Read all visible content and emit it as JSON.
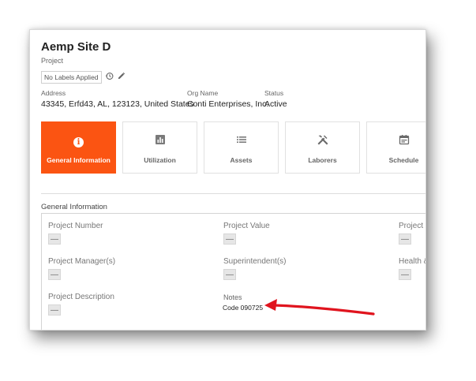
{
  "header": {
    "title": "Aemp Site D",
    "subtitle": "Project",
    "labels_chip": "No Labels Applied"
  },
  "meta": {
    "address_label": "Address",
    "address_value": "43345, Erfd43, AL, 123123, United States",
    "org_label": "Org Name",
    "org_value": "Conti Enterprises, Inc.",
    "status_label": "Status",
    "status_value": "Active"
  },
  "tabs": [
    {
      "label": "General Information",
      "icon": "info-icon",
      "active": true
    },
    {
      "label": "Utilization",
      "icon": "chart-icon",
      "active": false
    },
    {
      "label": "Assets",
      "icon": "list-icon",
      "active": false
    },
    {
      "label": "Laborers",
      "icon": "tools-icon",
      "active": false
    },
    {
      "label": "Schedule",
      "icon": "calendar-icon",
      "active": false
    }
  ],
  "section": {
    "title": "General Information",
    "fields": {
      "project_number": {
        "label": "Project Number",
        "value": "—"
      },
      "project_value": {
        "label": "Project Value",
        "value": "—"
      },
      "project_third": {
        "label": "Project",
        "value": "—"
      },
      "project_managers": {
        "label": "Project Manager(s)",
        "value": "—"
      },
      "superintendents": {
        "label": "Superintendent(s)",
        "value": "—"
      },
      "health": {
        "label": "Health &",
        "value": "—"
      },
      "project_description": {
        "label": "Project Description",
        "value": "—"
      },
      "notes": {
        "label": "Notes",
        "value": "Code 090725"
      }
    }
  },
  "colors": {
    "accent": "#fb5412",
    "annotation_arrow": "#e0141e"
  }
}
